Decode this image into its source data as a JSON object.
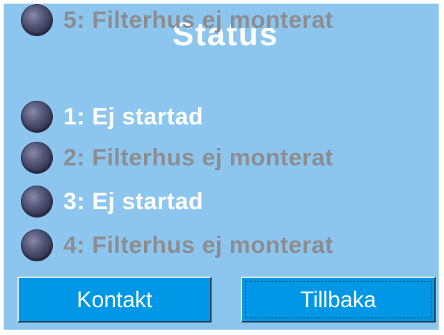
{
  "title": "Status",
  "statuses": [
    {
      "prefix": "1:",
      "text": "Ej startad",
      "state": "active"
    },
    {
      "prefix": "2:",
      "text": "Filterhus ej monterat",
      "state": "inactive"
    },
    {
      "prefix": "3:",
      "text": "Ej startad",
      "state": "active"
    },
    {
      "prefix": "4:",
      "text": "Filterhus ej monterat",
      "state": "inactive"
    },
    {
      "prefix": "5:",
      "text": "Filterhus ej monterat",
      "state": "inactive"
    }
  ],
  "buttons": {
    "contact": "Kontakt",
    "back": "Tillbaka"
  },
  "colors": {
    "background": "#8cc6ee",
    "button": "#0097e6",
    "active_text": "#ffffff",
    "inactive_text": "#8d8d91",
    "led": "#4a4d6e"
  }
}
